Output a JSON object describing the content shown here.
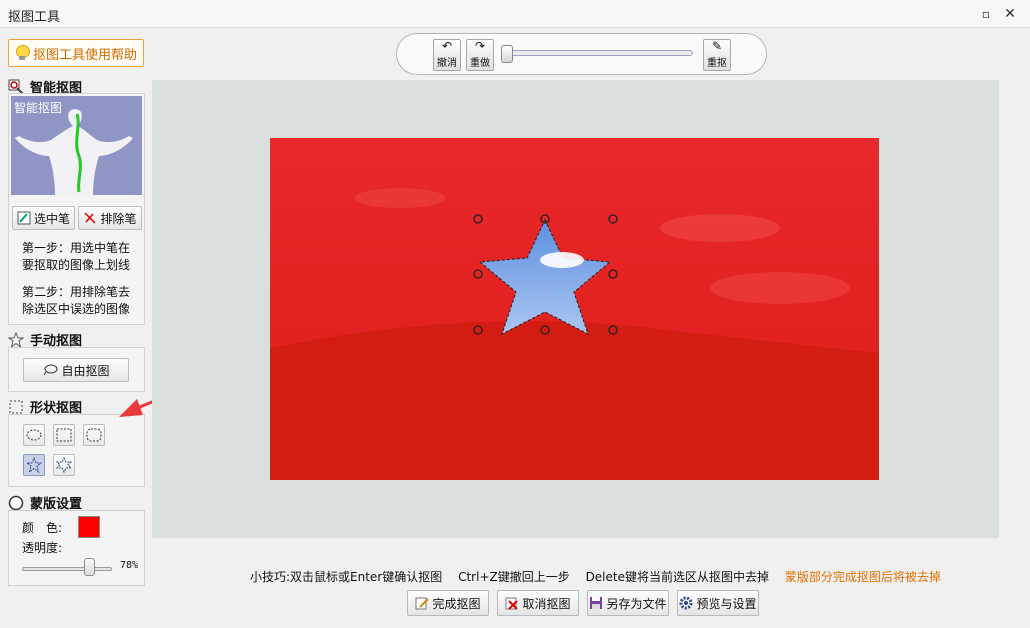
{
  "window": {
    "title": "抠图工具",
    "maximize_glyph": "▫",
    "close_glyph": "✕"
  },
  "help_button": {
    "label": "抠图工具使用帮助",
    "icon": "bulb-icon"
  },
  "smart_cutout": {
    "title": "智能抠图",
    "preview_label": "智能抠图",
    "select_pen": "选中笔",
    "erase_pen": "排除笔",
    "step1": "第一步：用选中笔在要抠取的图像上划线",
    "step2": "第二步：用排除笔去除选区中误选的图像"
  },
  "manual_cutout": {
    "title": "手动抠图",
    "free_button": "自由抠图"
  },
  "shape_cutout": {
    "title": "形状抠图",
    "shapes": [
      "ellipse-icon",
      "rectangle-icon",
      "rounded-rect-icon",
      "star-icon",
      "hexagram-icon"
    ],
    "active_shape": "star-icon"
  },
  "mask_settings": {
    "title": "蒙版设置",
    "color_label": "颜　色:",
    "color": "#ff0000",
    "opacity_label": "透明度:",
    "opacity_value": "78%",
    "opacity": 0.78
  },
  "toolbar": {
    "undo": "撤消",
    "redo": "重做",
    "retake": "重抠",
    "zoom": 0.0
  },
  "tips": {
    "tip1": "小技巧:双击鼠标或Enter键确认抠图",
    "tip2": "Ctrl+Z键撤回上一步",
    "tip3": "Delete键将当前选区从抠图中去掉",
    "tip4": "蒙版部分完成抠图后将被去掉"
  },
  "bottom_buttons": {
    "done": "完成抠图",
    "cancel": "取消抠图",
    "save_as": "另存为文件",
    "preview": "预览与设置"
  },
  "colors": {
    "accent_orange": "#e07000",
    "mask_red": "#ff0000",
    "canvas_bg": "#d9dfdd"
  }
}
